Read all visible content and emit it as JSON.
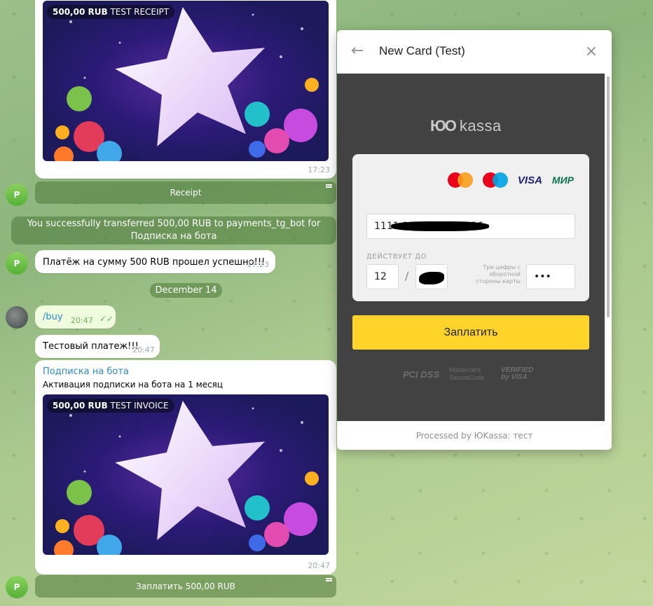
{
  "chat": {
    "receipt_card": {
      "badge_amount": "500,00 RUB",
      "badge_label": "TEST RECEIPT",
      "time": "17:23"
    },
    "receipt_button": "Receipt",
    "service_message": "You successfully transferred 500,00 RUB to payments_tg_bot for Подписка на бота",
    "payment_msg": {
      "text": "Платёж на сумму 500 RUB прошел успешно!!!",
      "time": "17:23"
    },
    "date_separator": "December 14",
    "buy_msg": {
      "text": "/buy",
      "time": "20:47"
    },
    "test_msg": {
      "text": "Тестовый платеж!!!",
      "time": "20:47"
    },
    "invoice": {
      "title": "Подписка на бота",
      "description": "Активация подписки на бота на 1 месяц",
      "badge_amount": "500,00 RUB",
      "badge_label": "TEST INVOICE",
      "time": "20:47"
    },
    "pay_button": "Заплатить 500,00 RUB",
    "avatar_letter": "P"
  },
  "payment": {
    "title": "New Card (Test)",
    "provider_logo": "kassa",
    "card_number": "1111 1111 1111 1026",
    "valid_label": "ДЕЙСТВУЕТ ДО",
    "expiry_month": "12",
    "expiry_separator": "/",
    "cvc_hint": "Три цифры с оборотной стороны карты",
    "cvc_value": "•••",
    "submit": "Заплатить",
    "security": {
      "pci": "PCI DSS",
      "mastercard": "Mastercard SecureCode",
      "visa": "VERIFIED by VISA"
    },
    "footer": "Processed by ЮKassa: тест",
    "brands": [
      "mastercard",
      "maestro",
      "VISA",
      "МИР"
    ]
  },
  "colors": {
    "pay_button": "#fed42b",
    "frame_bg": "#424242",
    "link": "#2a88c9",
    "bot_button": "#4c7838"
  }
}
